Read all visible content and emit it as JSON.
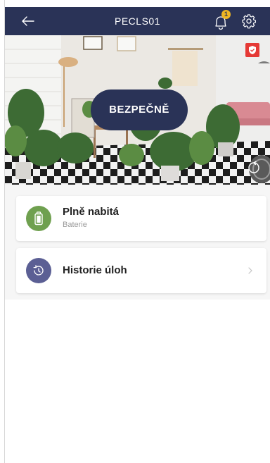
{
  "header": {
    "title": "PECLS01",
    "notification_count": "1",
    "bg_color": "#2a3357"
  },
  "hero": {
    "status_label": "BEZPEČNĚ",
    "shield_color": "#e53935"
  },
  "cards": {
    "battery": {
      "title": "Plně nabitá",
      "subtitle": "Baterie",
      "icon": "battery-icon",
      "icon_color": "#6fa04f"
    },
    "history": {
      "title": "Historie úloh",
      "icon": "clock-history-icon",
      "icon_color": "#5b5f94"
    }
  }
}
